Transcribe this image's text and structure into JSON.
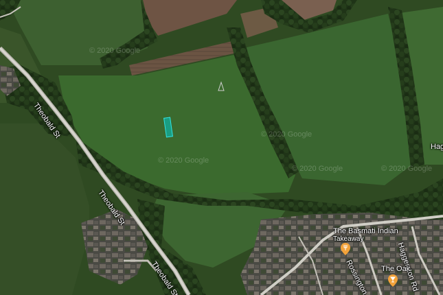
{
  "map": {
    "roads": {
      "theobald_upper": "Theobald St",
      "theobald_middle": "Theobald St",
      "theobald_lower": "Theobald St",
      "rossington": "Rossington Ave",
      "haggerston_vertical": "Haggerston Rd",
      "haggerston_edge": "Hag"
    },
    "pois": {
      "basmati_name": "The Basmati Indian",
      "basmati_sub": "Takeaway",
      "oak_name": "The Oak"
    },
    "pin_color": "#f2a23a",
    "parcel_color": "#33e0e0",
    "watermarks": [
      "© 2020 Google",
      "© 2020 Google",
      "© 2020 Google",
      "© 2020 Google",
      "© 2020 Google"
    ]
  }
}
